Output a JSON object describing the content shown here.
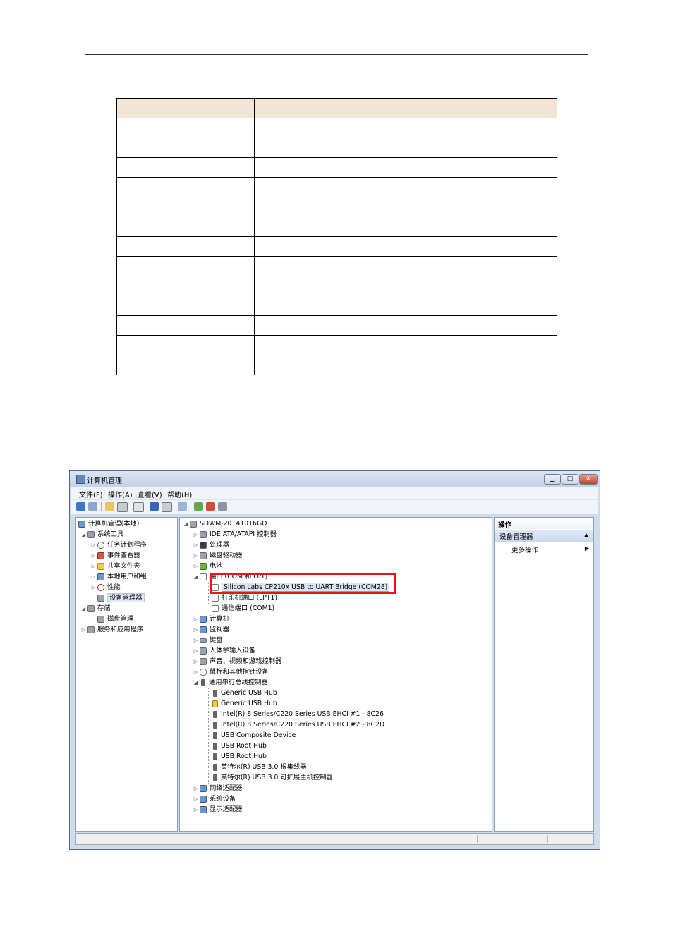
{
  "param_table": {
    "rows": [
      {
        "c1": "",
        "c2": ""
      },
      {
        "c1": "",
        "c2": ""
      },
      {
        "c1": "",
        "c2": ""
      },
      {
        "c1": "",
        "c2": ""
      },
      {
        "c1": "",
        "c2": ""
      },
      {
        "c1": "",
        "c2": ""
      },
      {
        "c1": "",
        "c2": ""
      },
      {
        "c1": "",
        "c2": ""
      },
      {
        "c1": "",
        "c2": ""
      },
      {
        "c1": "",
        "c2": ""
      },
      {
        "c1": "",
        "c2": ""
      },
      {
        "c1": "",
        "c2": ""
      },
      {
        "c1": "",
        "c2": ""
      },
      {
        "c1": "",
        "c2": ""
      }
    ]
  },
  "window": {
    "title": "计算机管理",
    "controls": {
      "minimize": "▁",
      "maximize": "□",
      "close": "✕"
    },
    "menu": [
      "文件(F)",
      "操作(A)",
      "查看(V)",
      "帮助(H)"
    ],
    "toolbar_icons": [
      "back-arrow",
      "forward-arrow",
      "up-folder",
      "show-hide-tree",
      "properties",
      "help",
      "show-pane",
      "scan-hardware",
      "update-driver",
      "uninstall",
      "disable"
    ]
  },
  "left_tree": {
    "root": "计算机管理(本地)",
    "system_tools": "系统工具",
    "task_scheduler": "任务计划程序",
    "event_viewer": "事件查看器",
    "shared_folders": "共享文件夹",
    "local_users": "本地用户和组",
    "performance": "性能",
    "device_manager": "设备管理器",
    "storage": "存储",
    "disk_management": "磁盘管理",
    "services_apps": "服务和应用程序"
  },
  "device_tree": {
    "computer_name": "SDWM-20141016GO",
    "ide": "IDE ATA/ATAPI 控制器",
    "processor": "处理器",
    "disk_drives": "磁盘驱动器",
    "battery": "电池",
    "ports": "端口 (COM 和 LPT)",
    "cp210x": "Silicon Labs CP210x USB to UART Bridge (COM28)",
    "printer_port": "打印机端口 (LPT1)",
    "comm_port": "通信端口 (COM1)",
    "computer": "计算机",
    "monitors": "监视器",
    "keyboards": "键盘",
    "hid": "人体学输入设备",
    "sound": "声音、视频和游戏控制器",
    "mice": "鼠标和其他指针设备",
    "usb_controllers": "通用串行总线控制器",
    "usb_children": [
      "Generic USB Hub",
      "Generic USB Hub",
      "Intel(R) 8 Series/C220 Series USB EHCI #1 - 8C26",
      "Intel(R) 8 Series/C220 Series USB EHCI #2 - 8C2D",
      "USB Composite Device",
      "USB Root Hub",
      "USB Root Hub",
      "英特尔(R) USB 3.0 根集线器",
      "英特尔(R) USB 3.0 可扩展主机控制器"
    ],
    "network": "网络适配器",
    "system_devices": "系统设备",
    "display": "显示适配器"
  },
  "actions": {
    "header": "操作",
    "group": "设备管理器",
    "group_arrow": "▲",
    "more": "更多操作",
    "more_arrow": "▶"
  },
  "tree_glyphs": {
    "expanded": "◢",
    "collapsed": "▷"
  }
}
